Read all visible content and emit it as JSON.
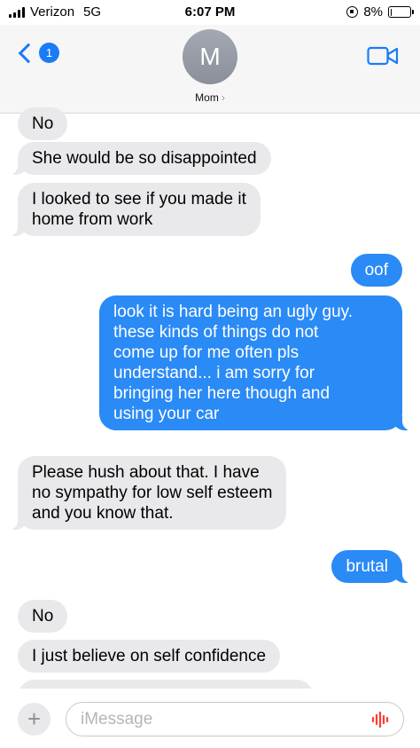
{
  "status_bar": {
    "carrier": "Verizon",
    "network": "5G",
    "time": "6:07 PM",
    "battery": "8%",
    "battery_level": 0.08
  },
  "header": {
    "back_badge": "1",
    "avatar_initial": "M",
    "contact_name": "Mom",
    "contact_chevron": "›"
  },
  "messages": [
    {
      "from": "them",
      "text": "No"
    },
    {
      "from": "them",
      "text": "She would be so disappointed"
    },
    {
      "from": "them",
      "text": "I looked to see if you made it\nhome from work"
    },
    {
      "from": "me",
      "text": "oof"
    },
    {
      "from": "me",
      "text": "look it is hard being an ugly guy.\nthese kinds of things do not\ncome up for me often pls\nunderstand... i am sorry for\nbringing her here though and\nusing your car"
    },
    {
      "from": "them",
      "text": "Please hush about that. I have\nno sympathy for low self esteem\nand you know that."
    },
    {
      "from": "me",
      "text": "brutal"
    },
    {
      "from": "them",
      "text": "No"
    },
    {
      "from": "them",
      "text": "I just believe on self confidence"
    }
  ],
  "input": {
    "plus_label": "+",
    "placeholder": "iMessage"
  },
  "colors": {
    "outgoing": "#2a8af6",
    "incoming": "#e9e9eb",
    "accent": "#1a7cf5",
    "mic": "#ff3b30"
  }
}
